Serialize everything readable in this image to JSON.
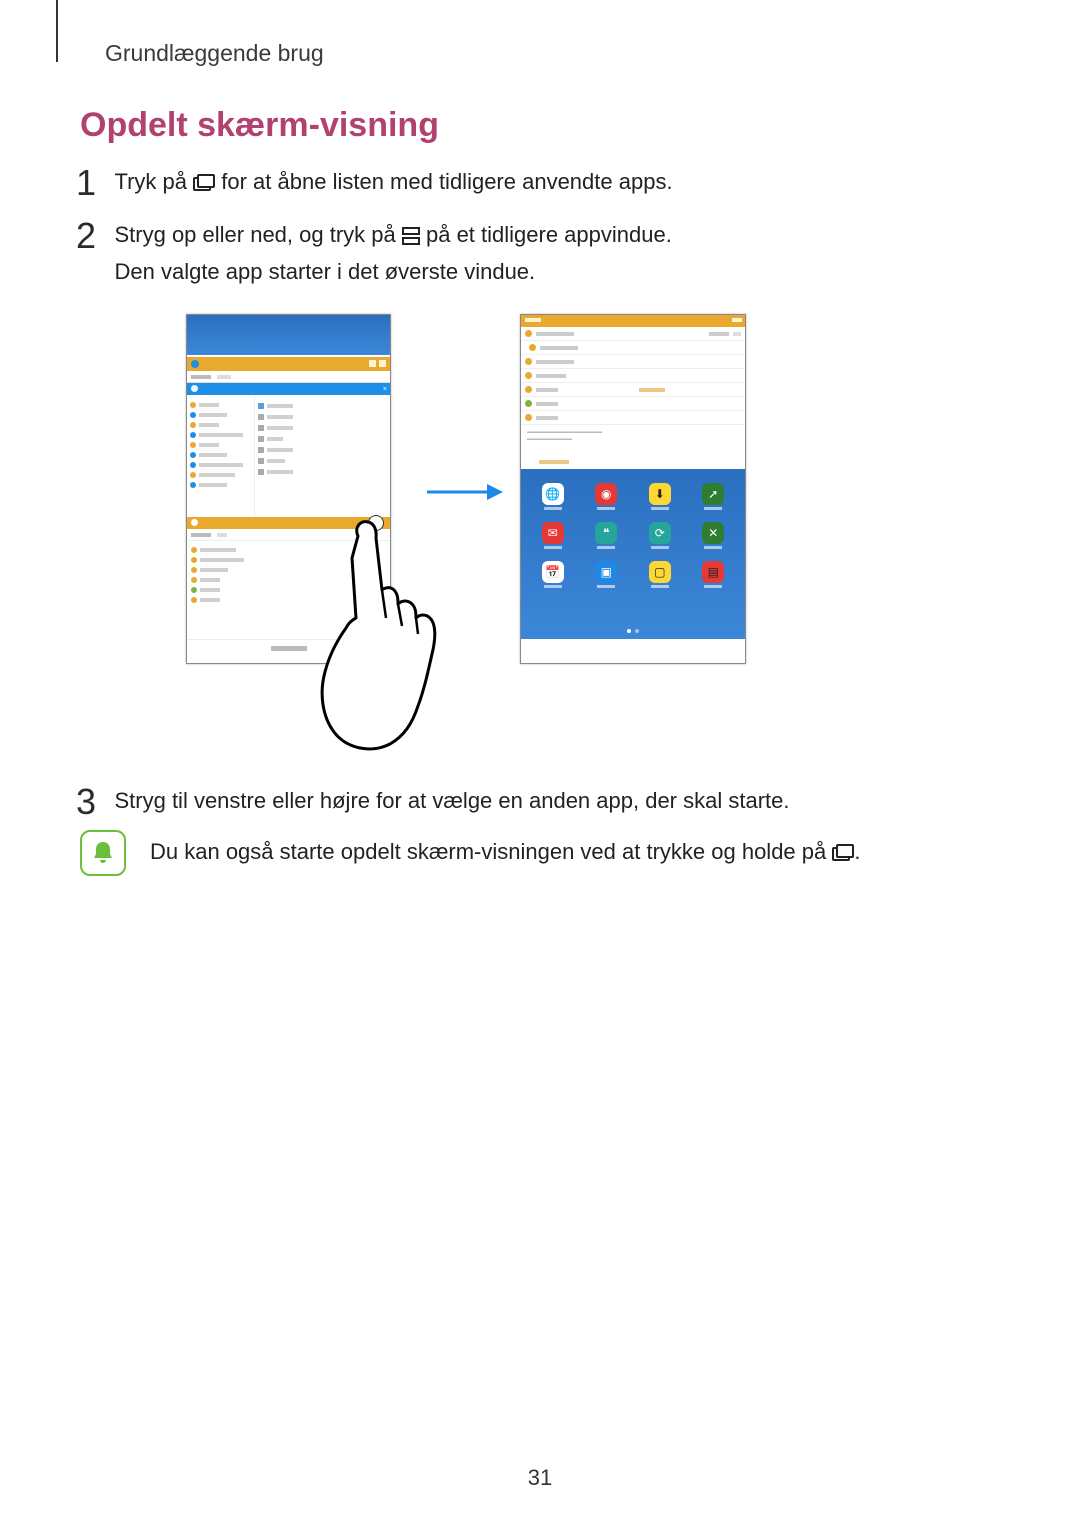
{
  "header": "Grundlæggende brug",
  "heading": "Opdelt skærm-visning",
  "steps": {
    "s1": {
      "num": "1",
      "pre": "Tryk på ",
      "post": " for at åbne listen med tidligere anvendte apps."
    },
    "s2": {
      "num": "2",
      "pre": "Stryg op eller ned, og tryk på ",
      "post": " på et tidligere appvindue.",
      "line2": "Den valgte app starter i det øverste vindue."
    },
    "s3": {
      "num": "3",
      "text": "Stryg til venstre eller højre for at vælge en anden app, der skal starte."
    }
  },
  "note": {
    "pre": "Du kan også starte opdelt skærm-visningen ved at trykke og holde på ",
    "post": "."
  },
  "page_number": "31"
}
